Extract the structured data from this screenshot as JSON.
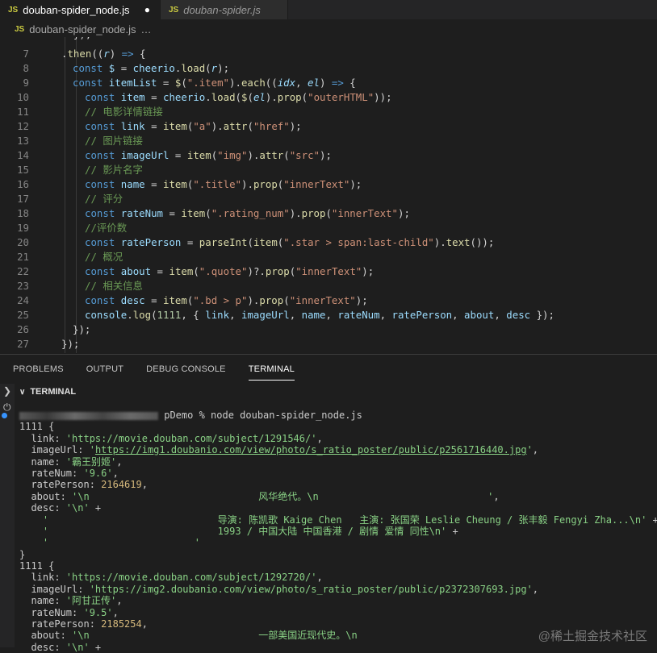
{
  "tabs": [
    {
      "label": "douban-spider_node.js",
      "icon": "JS",
      "modified": "●"
    },
    {
      "label": "douban-spider.js",
      "icon": "JS"
    }
  ],
  "breadcrumb": {
    "icon": "JS",
    "file": "douban-spider_node.js",
    "more": "…"
  },
  "editor": {
    "line_numbers": [
      "7",
      "8",
      "9",
      "10",
      "11",
      "12",
      "13",
      "14",
      "15",
      "16",
      "17",
      "18",
      "19",
      "20",
      "21",
      "22",
      "23",
      "24",
      "25",
      "26",
      "27"
    ]
  },
  "panel": {
    "tabs": [
      "PROBLEMS",
      "OUTPUT",
      "DEBUG CONSOLE",
      "TERMINAL"
    ],
    "active_tab": "TERMINAL",
    "terminal_label": "TERMINAL"
  },
  "terminal": {
    "prompt_suffix": " pDemo % node douban-spider_node.js",
    "lines": [
      "1111 {",
      "  link: 'https://movie.douban.com/subject/1291546/',",
      "  imageUrl: 'https://img1.doubanio.com/view/photo/s_ratio_poster/public/p2561716440.jpg',",
      "  name: '霸王别姬',",
      "  rateNum: '9.6',",
      "  ratePerson: 2164619,",
      "  about: '\\n                             风华绝代。\\n                             ',",
      "  desc: '\\n' +",
      "    '                             导演: 陈凯歌 Kaige Chen   主演: 张国荣 Leslie Cheung / 张丰毅 Fengyi Zha...\\n' +",
      "    '                             1993 / 中国大陆 中国香港 / 剧情 爱情 同性\\n' +",
      "    '                         '",
      "}",
      "1111 {",
      "  link: 'https://movie.douban.com/subject/1292720/',",
      "  imageUrl: 'https://img2.doubanio.com/view/photo/s_ratio_poster/public/p2372307693.jpg',",
      "  name: '阿甘正传',",
      "  rateNum: '9.5',",
      "  ratePerson: 2185254,",
      "  about: '\\n                             一部美国近现代史。\\n",
      "  desc: '\\n' +"
    ]
  },
  "watermark": "@稀土掘金技术社区"
}
